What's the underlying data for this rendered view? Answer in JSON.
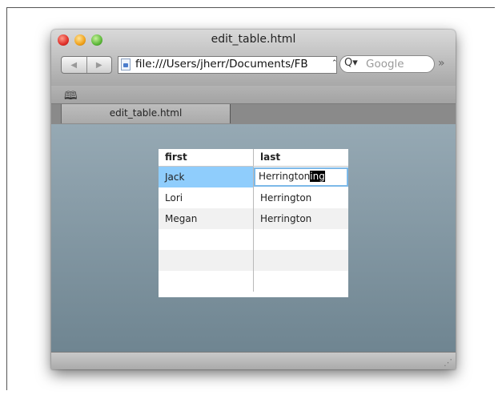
{
  "window": {
    "title": "edit_table.html",
    "url": "file:///Users/jherr/Documents/FB",
    "search_placeholder": "Google",
    "tab_label": "edit_table.html"
  },
  "table": {
    "headers": [
      "first",
      "last"
    ],
    "rows": [
      {
        "first": "Jack",
        "last": "Herrington",
        "last_typed": "Herrington",
        "last_selected": "ing",
        "editing": true,
        "selected": true
      },
      {
        "first": "Lori",
        "last": "Herrington"
      },
      {
        "first": "Megan",
        "last": "Herrington"
      },
      {
        "first": "",
        "last": ""
      },
      {
        "first": "",
        "last": ""
      },
      {
        "first": "",
        "last": ""
      }
    ]
  },
  "icons": {
    "back": "back-arrow-icon",
    "forward": "forward-arrow-icon",
    "page": "page-icon",
    "search": "magnifier-icon",
    "overflow": "chevron-double-right-icon",
    "bookmarks": "open-book-icon",
    "resize": "resize-grip-icon"
  }
}
